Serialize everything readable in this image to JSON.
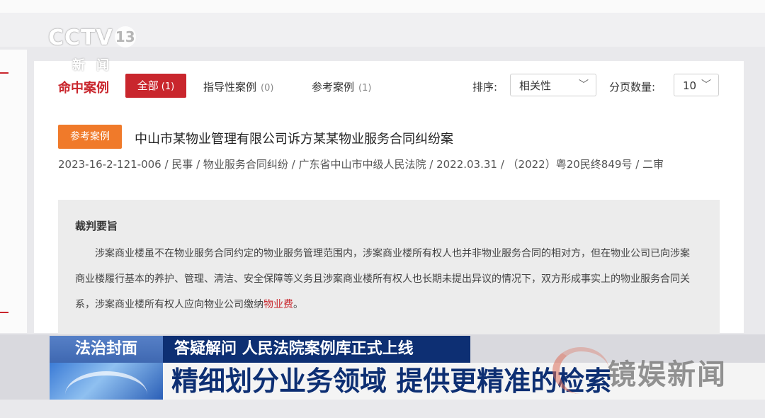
{
  "logo": {
    "brand": "CCTV",
    "channel": "13",
    "sub": "新闻"
  },
  "results": {
    "hits_label": "命中案例",
    "tabs": [
      {
        "label": "全部",
        "count": "(1)"
      },
      {
        "label": "指导性案例",
        "count": "(0)"
      },
      {
        "label": "参考案例",
        "count": "(1)"
      }
    ],
    "sort_label": "排序:",
    "sort_value": "相关性",
    "page_size_label": "分页数量:",
    "page_size_value": "10"
  },
  "case": {
    "badge": "参考案例",
    "title": "中山市某物业管理有限公司诉方某某物业服务合同纠纷案",
    "meta": "2023-16-2-121-006 / 民事 / 物业服务合同纠纷 / 广东省中山市中级人民法院 / 2022.03.31 / （2022）粤20民终849号 / 二审",
    "gist_heading": "裁判要旨",
    "gist_text": "涉案商业楼虽不在物业服务合同约定的物业服务管理范围内，涉案商业楼所有权人也并非物业服务合同的相对方，但在物业公司已向涉案商业楼履行基本的养护、管理、清洁、安全保障等义务且涉案商业楼所有权人也长期未提出异议的情况下，双方形成事实上的物业服务合同关系，涉案商业楼所有权人应向物业公司缴纳",
    "gist_highlight": "物业费",
    "gist_end": "。"
  },
  "broadcast": {
    "program": "法治封面",
    "headline_top": "答疑解问 人民法院案例库正式上线",
    "headline_main": "精细划分业务领域 提供更精准的检索",
    "watermark": "镜娱新闻"
  },
  "colors": {
    "accent_red": "#c9262d",
    "badge_orange": "#f07a2a",
    "banner_navy": "#0d2f73"
  }
}
